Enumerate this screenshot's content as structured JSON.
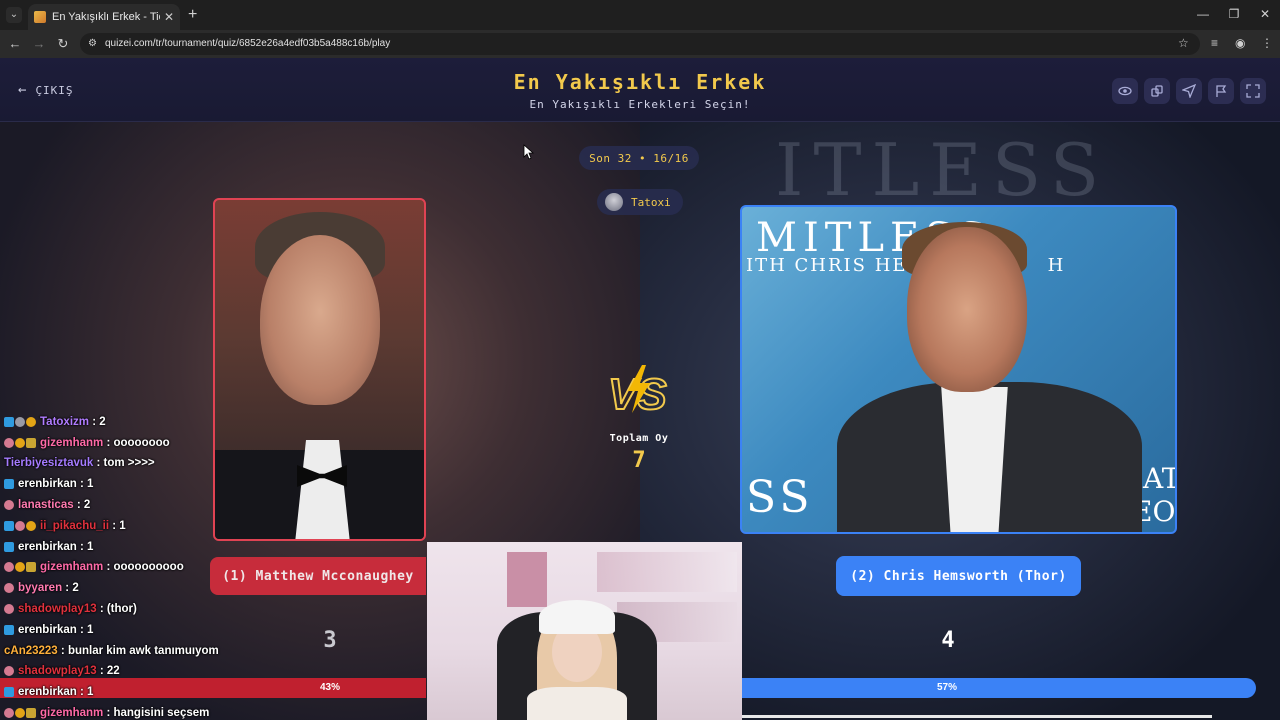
{
  "browser": {
    "tab_title": "En Yakışıklı Erkek - Tier List, Kon",
    "url": "quizei.com/tr/tournament/quiz/6852e26a4edf03b5a488c16b/play"
  },
  "header": {
    "exit_label": "ÇIKIŞ",
    "title": "En Yakışıklı Erkek",
    "subtitle": "En Yakışıklı Erkekleri Seçin!"
  },
  "round": {
    "label": "Son 32 • 16/16",
    "user": "Tatoxi"
  },
  "center": {
    "total_label": "Toplam Oy",
    "total_value": "7"
  },
  "left": {
    "name": "(1) Matthew Mcconaughey",
    "votes": "3",
    "percent_label": "43%",
    "percent": 43,
    "color": "#c0202f"
  },
  "right": {
    "name": "(2) Chris Hemsworth (Thor)",
    "votes": "4",
    "percent_label": "57%",
    "percent": 57,
    "color": "#3b82f6",
    "photo_text1": "MITLESS",
    "photo_text2": "ITH CHRIS HE",
    "photo_text2b": "H",
    "photo_text3": "SS",
    "photo_text4": "IAT EO"
  },
  "background_text": "ITLESS",
  "chat": [
    {
      "badges": [],
      "user": "",
      "user_color": "#ffffff",
      "msg": ""
    },
    {
      "badges": [
        "b-blue",
        "b-grey",
        "b-gold"
      ],
      "user": "Tatoxizm",
      "user_color": "#b07cff",
      "msg": ": 2"
    },
    {
      "badges": [
        "b-pink",
        "b-gold",
        "b-gift"
      ],
      "user": "gizemhanm",
      "user_color": "#ff6aa8",
      "msg": ": oooooooo"
    },
    {
      "badges": [],
      "user": "Tierbiyesiztavuk",
      "user_color": "#a57bff",
      "msg": ": tom >>>>"
    },
    {
      "badges": [
        "b-blue"
      ],
      "user": "erenbirkan",
      "user_color": "#ffffff",
      "msg": ": 1"
    },
    {
      "badges": [
        "b-pink"
      ],
      "user": "lanasticas",
      "user_color": "#ff7ab0",
      "msg": ": 2"
    },
    {
      "badges": [
        "b-blue",
        "b-pink",
        "b-gold"
      ],
      "user": "ii_pikachu_ii",
      "user_color": "#e0313d",
      "msg": ": 1"
    },
    {
      "badges": [
        "b-blue"
      ],
      "user": "erenbirkan",
      "user_color": "#ffffff",
      "msg": ": 1"
    },
    {
      "badges": [
        "b-pink",
        "b-gold",
        "b-gift"
      ],
      "user": "gizemhanm",
      "user_color": "#ff6aa8",
      "msg": ": oooooooooo"
    },
    {
      "badges": [
        "b-pink"
      ],
      "user": "byyaren",
      "user_color": "#ff7ab0",
      "msg": ": 2"
    },
    {
      "badges": [
        "b-pink"
      ],
      "user": "shadowplay13",
      "user_color": "#e0313d",
      "msg": ": (thor)"
    },
    {
      "badges": [
        "b-blue"
      ],
      "user": "erenbirkan",
      "user_color": "#ffffff",
      "msg": ": 1"
    },
    {
      "badges": [],
      "user": "cAn23223",
      "user_color": "#ffb03b",
      "msg": ": bunlar kim awk tanımuıyom"
    },
    {
      "badges": [
        "b-pink"
      ],
      "user": "shadowplay13",
      "user_color": "#e0313d",
      "msg": ": 22"
    },
    {
      "badges": [
        "b-blue"
      ],
      "user": "erenbirkan",
      "user_color": "#ffffff",
      "msg": ": 1"
    },
    {
      "badges": [
        "b-pink",
        "b-gold",
        "b-gift"
      ],
      "user": "gizemhanm",
      "user_color": "#ff6aa8",
      "msg": ": hangisini seçsem"
    }
  ],
  "icons": {
    "header": [
      "eye-icon",
      "share-icon",
      "send-icon",
      "flag-icon",
      "fullscreen-icon"
    ]
  }
}
